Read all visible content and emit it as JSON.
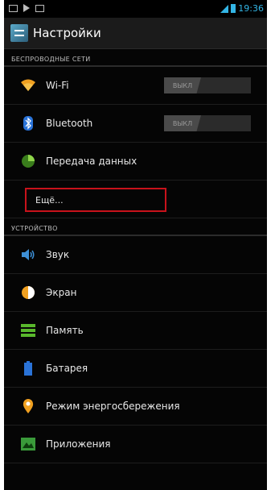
{
  "statusbar": {
    "time": "19:36"
  },
  "actionbar": {
    "title": "Настройки"
  },
  "sections": {
    "wireless": "БЕСПРОВОДНЫЕ СЕТИ",
    "device": "УСТРОЙСТВО"
  },
  "wireless_items": {
    "wifi": {
      "label": "Wi-Fi",
      "toggle": "ВЫКЛ"
    },
    "bluetooth": {
      "label": "Bluetooth",
      "toggle": "ВЫКЛ"
    },
    "data": {
      "label": "Передача данных"
    },
    "more": {
      "label": "Ещё..."
    }
  },
  "device_items": {
    "sound": "Звук",
    "screen": "Экран",
    "memory": "Память",
    "battery": "Батарея",
    "power_saving": "Режим энергосбережения",
    "apps": "Приложения"
  },
  "colors": {
    "accent": "#33b5e5",
    "highlight": "#c8121b"
  }
}
